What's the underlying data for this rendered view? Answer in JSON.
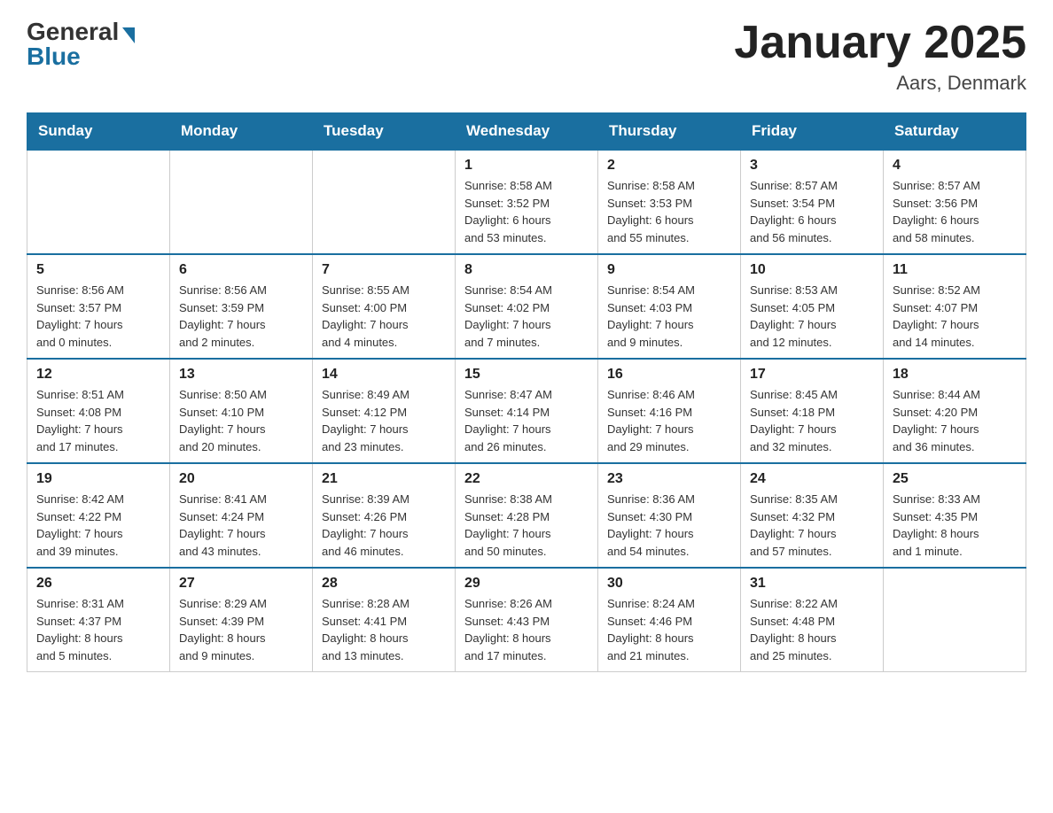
{
  "header": {
    "logo_general": "General",
    "logo_blue": "Blue",
    "month_year": "January 2025",
    "location": "Aars, Denmark"
  },
  "days_of_week": [
    "Sunday",
    "Monday",
    "Tuesday",
    "Wednesday",
    "Thursday",
    "Friday",
    "Saturday"
  ],
  "weeks": [
    [
      {
        "day": "",
        "info": ""
      },
      {
        "day": "",
        "info": ""
      },
      {
        "day": "",
        "info": ""
      },
      {
        "day": "1",
        "info": "Sunrise: 8:58 AM\nSunset: 3:52 PM\nDaylight: 6 hours\nand 53 minutes."
      },
      {
        "day": "2",
        "info": "Sunrise: 8:58 AM\nSunset: 3:53 PM\nDaylight: 6 hours\nand 55 minutes."
      },
      {
        "day": "3",
        "info": "Sunrise: 8:57 AM\nSunset: 3:54 PM\nDaylight: 6 hours\nand 56 minutes."
      },
      {
        "day": "4",
        "info": "Sunrise: 8:57 AM\nSunset: 3:56 PM\nDaylight: 6 hours\nand 58 minutes."
      }
    ],
    [
      {
        "day": "5",
        "info": "Sunrise: 8:56 AM\nSunset: 3:57 PM\nDaylight: 7 hours\nand 0 minutes."
      },
      {
        "day": "6",
        "info": "Sunrise: 8:56 AM\nSunset: 3:59 PM\nDaylight: 7 hours\nand 2 minutes."
      },
      {
        "day": "7",
        "info": "Sunrise: 8:55 AM\nSunset: 4:00 PM\nDaylight: 7 hours\nand 4 minutes."
      },
      {
        "day": "8",
        "info": "Sunrise: 8:54 AM\nSunset: 4:02 PM\nDaylight: 7 hours\nand 7 minutes."
      },
      {
        "day": "9",
        "info": "Sunrise: 8:54 AM\nSunset: 4:03 PM\nDaylight: 7 hours\nand 9 minutes."
      },
      {
        "day": "10",
        "info": "Sunrise: 8:53 AM\nSunset: 4:05 PM\nDaylight: 7 hours\nand 12 minutes."
      },
      {
        "day": "11",
        "info": "Sunrise: 8:52 AM\nSunset: 4:07 PM\nDaylight: 7 hours\nand 14 minutes."
      }
    ],
    [
      {
        "day": "12",
        "info": "Sunrise: 8:51 AM\nSunset: 4:08 PM\nDaylight: 7 hours\nand 17 minutes."
      },
      {
        "day": "13",
        "info": "Sunrise: 8:50 AM\nSunset: 4:10 PM\nDaylight: 7 hours\nand 20 minutes."
      },
      {
        "day": "14",
        "info": "Sunrise: 8:49 AM\nSunset: 4:12 PM\nDaylight: 7 hours\nand 23 minutes."
      },
      {
        "day": "15",
        "info": "Sunrise: 8:47 AM\nSunset: 4:14 PM\nDaylight: 7 hours\nand 26 minutes."
      },
      {
        "day": "16",
        "info": "Sunrise: 8:46 AM\nSunset: 4:16 PM\nDaylight: 7 hours\nand 29 minutes."
      },
      {
        "day": "17",
        "info": "Sunrise: 8:45 AM\nSunset: 4:18 PM\nDaylight: 7 hours\nand 32 minutes."
      },
      {
        "day": "18",
        "info": "Sunrise: 8:44 AM\nSunset: 4:20 PM\nDaylight: 7 hours\nand 36 minutes."
      }
    ],
    [
      {
        "day": "19",
        "info": "Sunrise: 8:42 AM\nSunset: 4:22 PM\nDaylight: 7 hours\nand 39 minutes."
      },
      {
        "day": "20",
        "info": "Sunrise: 8:41 AM\nSunset: 4:24 PM\nDaylight: 7 hours\nand 43 minutes."
      },
      {
        "day": "21",
        "info": "Sunrise: 8:39 AM\nSunset: 4:26 PM\nDaylight: 7 hours\nand 46 minutes."
      },
      {
        "day": "22",
        "info": "Sunrise: 8:38 AM\nSunset: 4:28 PM\nDaylight: 7 hours\nand 50 minutes."
      },
      {
        "day": "23",
        "info": "Sunrise: 8:36 AM\nSunset: 4:30 PM\nDaylight: 7 hours\nand 54 minutes."
      },
      {
        "day": "24",
        "info": "Sunrise: 8:35 AM\nSunset: 4:32 PM\nDaylight: 7 hours\nand 57 minutes."
      },
      {
        "day": "25",
        "info": "Sunrise: 8:33 AM\nSunset: 4:35 PM\nDaylight: 8 hours\nand 1 minute."
      }
    ],
    [
      {
        "day": "26",
        "info": "Sunrise: 8:31 AM\nSunset: 4:37 PM\nDaylight: 8 hours\nand 5 minutes."
      },
      {
        "day": "27",
        "info": "Sunrise: 8:29 AM\nSunset: 4:39 PM\nDaylight: 8 hours\nand 9 minutes."
      },
      {
        "day": "28",
        "info": "Sunrise: 8:28 AM\nSunset: 4:41 PM\nDaylight: 8 hours\nand 13 minutes."
      },
      {
        "day": "29",
        "info": "Sunrise: 8:26 AM\nSunset: 4:43 PM\nDaylight: 8 hours\nand 17 minutes."
      },
      {
        "day": "30",
        "info": "Sunrise: 8:24 AM\nSunset: 4:46 PM\nDaylight: 8 hours\nand 21 minutes."
      },
      {
        "day": "31",
        "info": "Sunrise: 8:22 AM\nSunset: 4:48 PM\nDaylight: 8 hours\nand 25 minutes."
      },
      {
        "day": "",
        "info": ""
      }
    ]
  ]
}
